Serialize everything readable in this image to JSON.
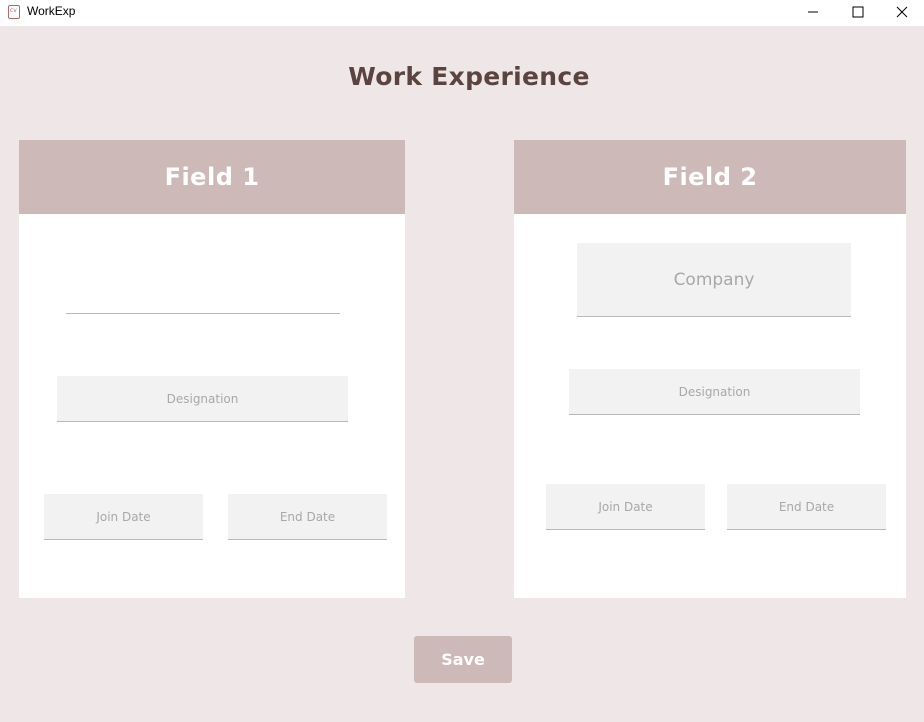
{
  "window": {
    "title": "WorkExp"
  },
  "page": {
    "title": "Work Experience"
  },
  "cards": [
    {
      "header": "Field 1",
      "company_value": "",
      "designation_placeholder": "Designation",
      "join_date_placeholder": "Join Date",
      "end_date_placeholder": "End Date"
    },
    {
      "header": "Field 2",
      "company_placeholder": "Company",
      "designation_placeholder": "Designation",
      "join_date_placeholder": "Join Date",
      "end_date_placeholder": "End Date"
    }
  ],
  "actions": {
    "save_label": "Save"
  },
  "colors": {
    "background": "#efe7e7",
    "accent": "#cdb9b7",
    "title_text": "#5b4440",
    "field_bg": "#f2f2f2",
    "placeholder_text": "#a8a8a8"
  }
}
